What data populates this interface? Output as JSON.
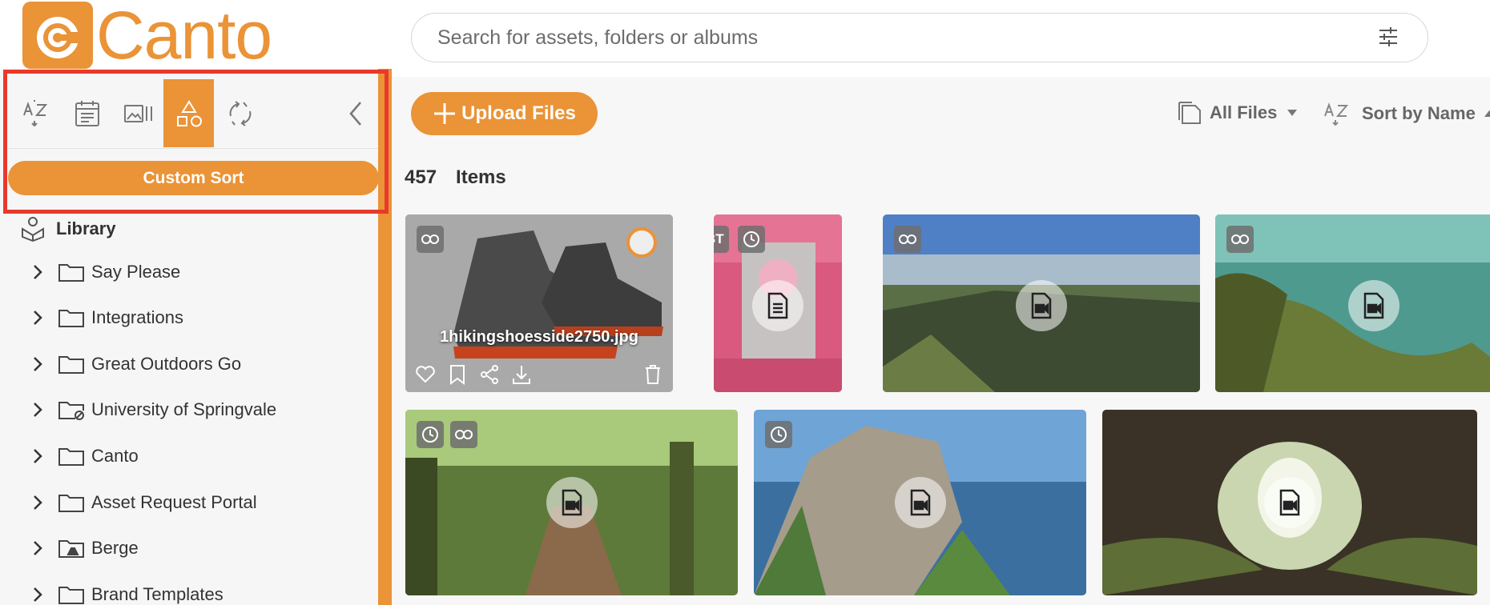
{
  "app": {
    "brand": "Canto",
    "accent": "#ea9337",
    "highlight": "#e8392b"
  },
  "search": {
    "placeholder": "Search for assets, folders or albums",
    "value": ""
  },
  "sidebar": {
    "toolbar": [
      {
        "icon": "sort-az-icon"
      },
      {
        "icon": "calendar-icon"
      },
      {
        "icon": "gallery-icon"
      },
      {
        "icon": "shapes-icon",
        "active": true
      },
      {
        "icon": "refresh-icon"
      },
      {
        "icon": "collapse-icon"
      }
    ],
    "custom_sort_label": "Custom Sort",
    "library_label": "Library",
    "tree": [
      {
        "label": "Say Please",
        "icon": "folder-icon"
      },
      {
        "label": "Integrations",
        "icon": "folder-icon"
      },
      {
        "label": "Great Outdoors Go",
        "icon": "folder-icon"
      },
      {
        "label": "University of Springvale",
        "icon": "restricted-folder-icon"
      },
      {
        "label": "Canto",
        "icon": "folder-icon"
      },
      {
        "label": "Asset Request Portal",
        "icon": "folder-icon"
      },
      {
        "label": "Berge",
        "icon": "drive-folder-icon"
      },
      {
        "label": "Brand Templates",
        "icon": "folder-icon"
      }
    ]
  },
  "main": {
    "upload_label": "Upload Files",
    "filter_label": "All Files",
    "sort_label": "Sort by Name",
    "item_count": "457",
    "items_label": "Items",
    "tiles": [
      {
        "name": "1hikingshoesside2750.jpg",
        "type": "image",
        "badges": [
          "link-icon"
        ]
      },
      {
        "name": "",
        "type": "document",
        "badges": [
          "BT",
          "clock-icon"
        ]
      },
      {
        "name": "",
        "type": "video",
        "badges": [
          "link-icon"
        ]
      },
      {
        "name": "",
        "type": "video",
        "badges": [
          "link-icon"
        ]
      },
      {
        "name": "",
        "type": "video",
        "badges": [
          "clock-icon",
          "link-icon"
        ]
      },
      {
        "name": "",
        "type": "video",
        "badges": [
          "clock-icon"
        ]
      },
      {
        "name": "",
        "type": "video",
        "badges": []
      }
    ],
    "tile_badge_text": "BT"
  }
}
